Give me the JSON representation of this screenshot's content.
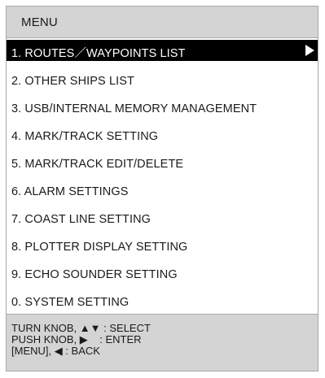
{
  "header": {
    "title": "MENU"
  },
  "menu": {
    "items": [
      {
        "label": "1. ROUTES／WAYPOINTS LIST",
        "selected": true,
        "arrow": "right-arrow-icon"
      },
      {
        "label": "2. OTHER SHIPS LIST"
      },
      {
        "label": "3. USB/INTERNAL MEMORY MANAGEMENT"
      },
      {
        "label": "4. MARK/TRACK SETTING"
      },
      {
        "label": "5. MARK/TRACK EDIT/DELETE"
      },
      {
        "label": "6. ALARM SETTINGS"
      },
      {
        "label": "7. COAST LINE SETTING"
      },
      {
        "label": "8. PLOTTER DISPLAY SETTING"
      },
      {
        "label": "9. ECHO SOUNDER SETTING"
      },
      {
        "label": "0. SYSTEM SETTING"
      }
    ]
  },
  "footer": {
    "lines": [
      "TURN KNOB, ▲▼ : SELECT",
      "PUSH KNOB, ▶    : ENTER",
      "[MENU], ◀ : BACK"
    ]
  },
  "colors": {
    "header_bg": "#d4d4d4",
    "selected_bg": "#000000",
    "selected_fg": "#ffffff",
    "border": "#a8a8a8"
  }
}
